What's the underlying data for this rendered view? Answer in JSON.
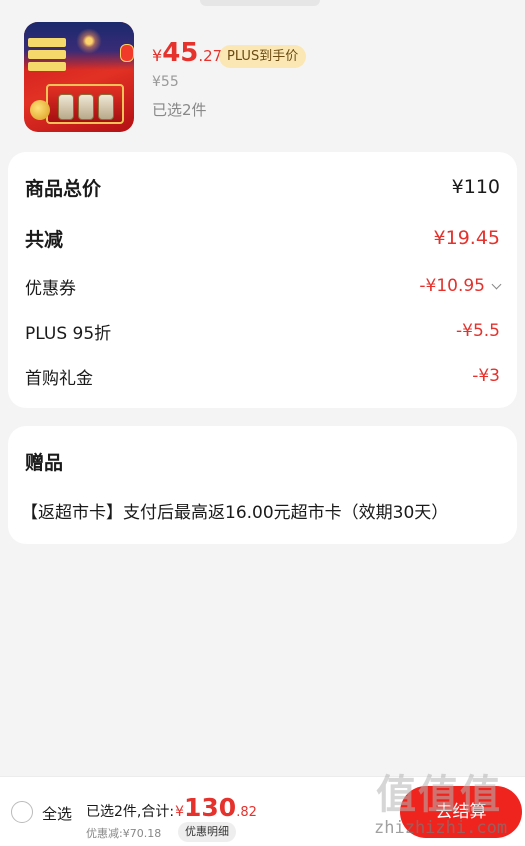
{
  "product": {
    "price_currency": "¥",
    "price_int": "45",
    "price_dec": ".27",
    "plus_tag": "PLUS到手价",
    "original_price": "¥55",
    "selected_count": "已选2件"
  },
  "summary": {
    "total_label": "商品总价",
    "total_value": "¥110",
    "reduce_label": "共减",
    "reduce_value": "¥19.45",
    "coupon_label": "优惠券",
    "coupon_value": "-¥10.95",
    "plus_label": "PLUS 95折",
    "plus_value": "-¥5.5",
    "first_label": "首购礼金",
    "first_value": "-¥3"
  },
  "gift": {
    "title": "赠品",
    "text": "【返超市卡】支付后最高返16.00元超市卡（效期30天）"
  },
  "bottom_bar": {
    "select_all": "全选",
    "selected_sum_text": "已选2件,合计:",
    "sum_currency": "¥",
    "sum_int": "130",
    "sum_dec": ".82",
    "discount_text": "优惠减:¥70.18",
    "detail_button": "优惠明细",
    "checkout_button": "去结算"
  },
  "watermark": {
    "big": "值值值",
    "small": "zhizhizhi.com"
  },
  "colors": {
    "accent_red": "#e5322d",
    "checkout_red": "#f0241f",
    "plus_tag_bg": "#fbe7b3"
  }
}
